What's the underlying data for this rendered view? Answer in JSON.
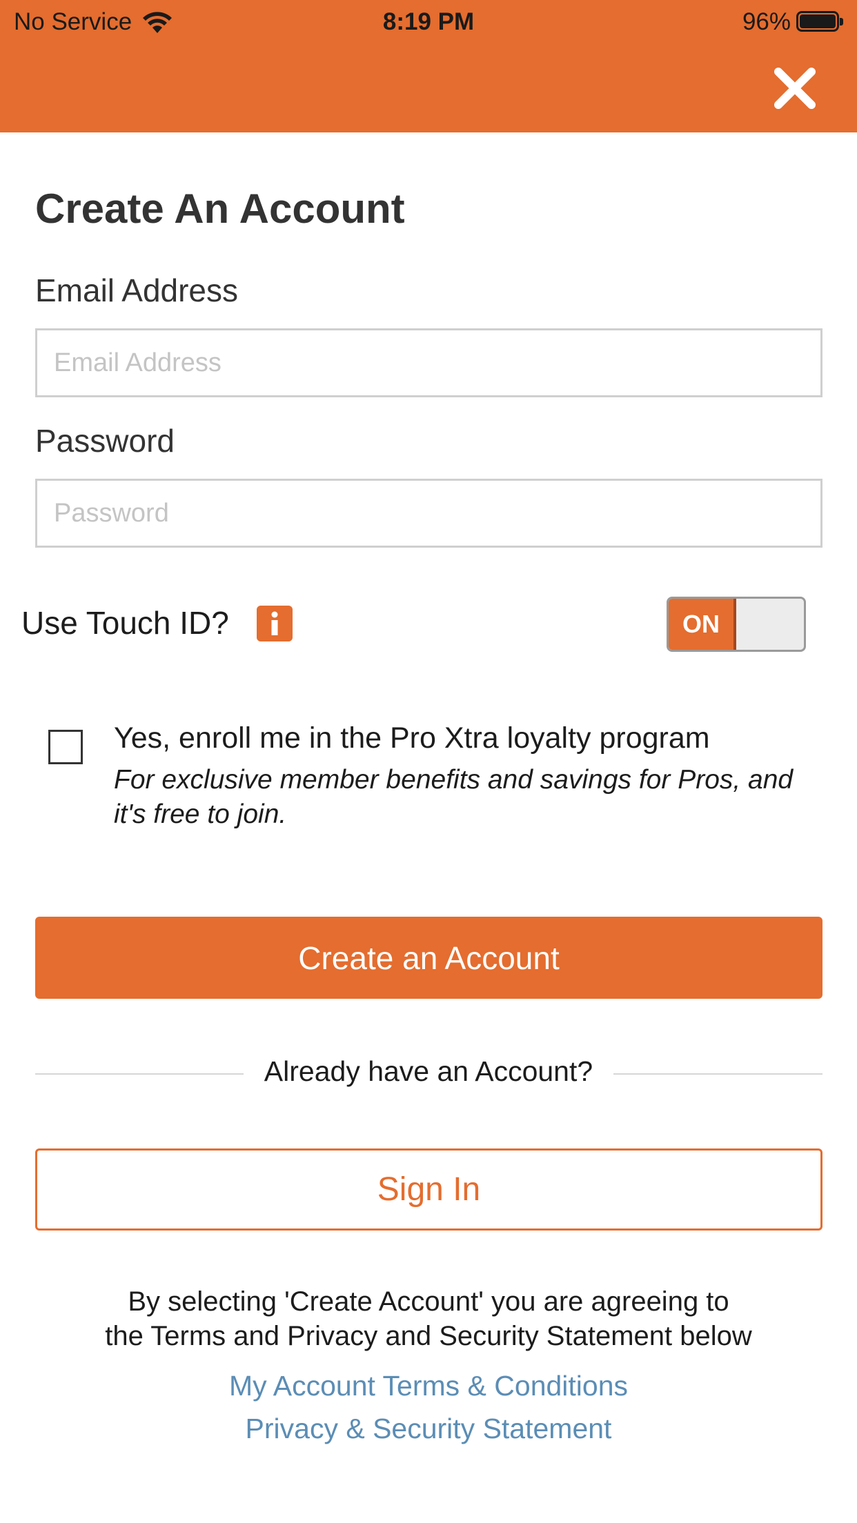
{
  "status_bar": {
    "carrier": "No Service",
    "time": "8:19 PM",
    "battery": "96%"
  },
  "header": {
    "close_icon": "close-icon",
    "accent_color": "#e46d2f"
  },
  "form": {
    "title": "Create An Account",
    "email_label": "Email Address",
    "email_placeholder": "Email Address",
    "email_value": "",
    "password_label": "Password",
    "password_placeholder": "Password",
    "password_value": "",
    "touch_id_label": "Use Touch ID?",
    "touch_id_info_icon": "info-icon",
    "touch_id_toggle": "ON",
    "touch_id_enabled": true,
    "enroll_checked": false,
    "enroll_title": "Yes, enroll me in the Pro Xtra loyalty program",
    "enroll_subtitle": "For exclusive member benefits and savings for Pros, and it's free to join."
  },
  "actions": {
    "create_label": "Create an Account",
    "already_label": "Already have an Account?",
    "signin_label": "Sign In"
  },
  "legal": {
    "notice_line1": "By selecting 'Create Account' you are agreeing to",
    "notice_line2": "the Terms and Privacy and Security Statement below",
    "terms_link": "My Account Terms & Conditions",
    "privacy_link": "Privacy & Security Statement",
    "link_color": "#5b8db5"
  }
}
